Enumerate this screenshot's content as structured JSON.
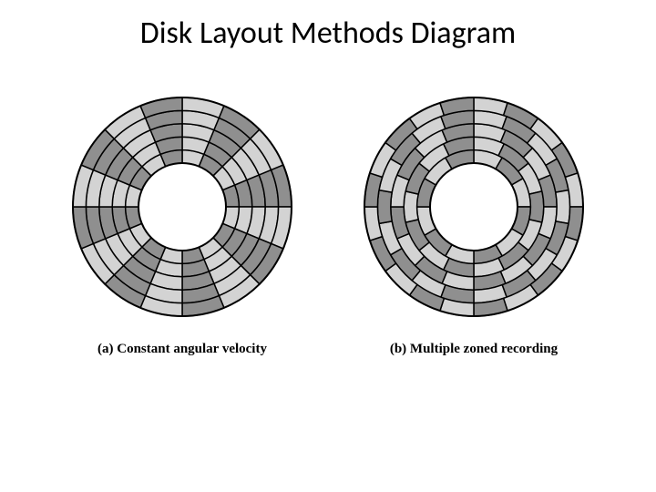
{
  "title": "Disk Layout Methods Diagram",
  "panels": [
    {
      "caption": "(a) Constant angular velocity"
    },
    {
      "caption": "(b) Multiple zoned recording"
    }
  ],
  "colors": {
    "light": "#d3d3d3",
    "dark": "#8f8f8f",
    "stroke": "#000000"
  },
  "chart_data": {
    "type": "other",
    "description": "Two schematic disk platters showing sector layout schemes.",
    "disks": [
      {
        "label": "(a) Constant angular velocity",
        "scheme": "CAV",
        "track_count": 5,
        "sectors_per_track": [
          16,
          16,
          16,
          16,
          16
        ],
        "note": "All tracks share identical angular sector boundaries; same number of sectors on every track."
      },
      {
        "label": "(b) Multiple zoned recording",
        "scheme": "MZR",
        "track_count": 5,
        "sectors_per_track": [
          12,
          14,
          16,
          18,
          20
        ],
        "note": "Outer tracks are divided into more sectors than inner tracks, increasing storage density on outer zones."
      }
    ],
    "inner_hole_radius_fraction": 0.4,
    "outer_radius_fraction": 1.0
  }
}
